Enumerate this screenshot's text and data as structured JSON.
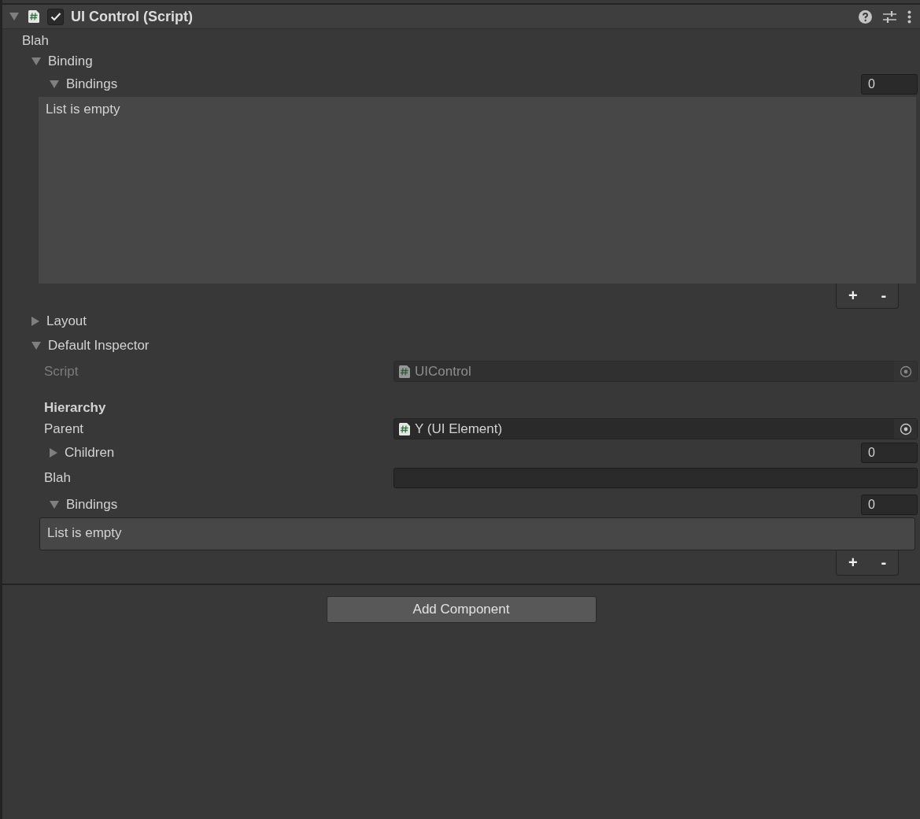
{
  "component": {
    "title": "UI Control (Script)",
    "enabled": true,
    "expanded": true
  },
  "label": "Blah",
  "binding_foldout": {
    "label": "Binding",
    "expanded": true
  },
  "bindings_list": {
    "label": "Bindings",
    "expanded": true,
    "count": "0",
    "empty_text": "List is empty",
    "add": "+",
    "remove": "-"
  },
  "layout_foldout": {
    "label": "Layout",
    "expanded": false
  },
  "default_inspector": {
    "label": "Default Inspector",
    "expanded": true,
    "fields": [
      {
        "kind": "object",
        "label": "Script",
        "value": "UIControl",
        "disabled": true
      },
      {
        "kind": "header",
        "label": "Hierarchy"
      },
      {
        "kind": "object",
        "label": "Parent",
        "value": "Y (UI Element)",
        "disabled": false
      },
      {
        "kind": "list_foldout",
        "label": "Children",
        "expanded": false,
        "count": "0"
      },
      {
        "kind": "text",
        "label": "Blah"
      },
      {
        "kind": "list",
        "label": "Bindings",
        "expanded": true,
        "count": "0",
        "empty_text": "List is empty",
        "add": "+",
        "remove": "-"
      }
    ]
  },
  "add_component_button": "Add Component"
}
